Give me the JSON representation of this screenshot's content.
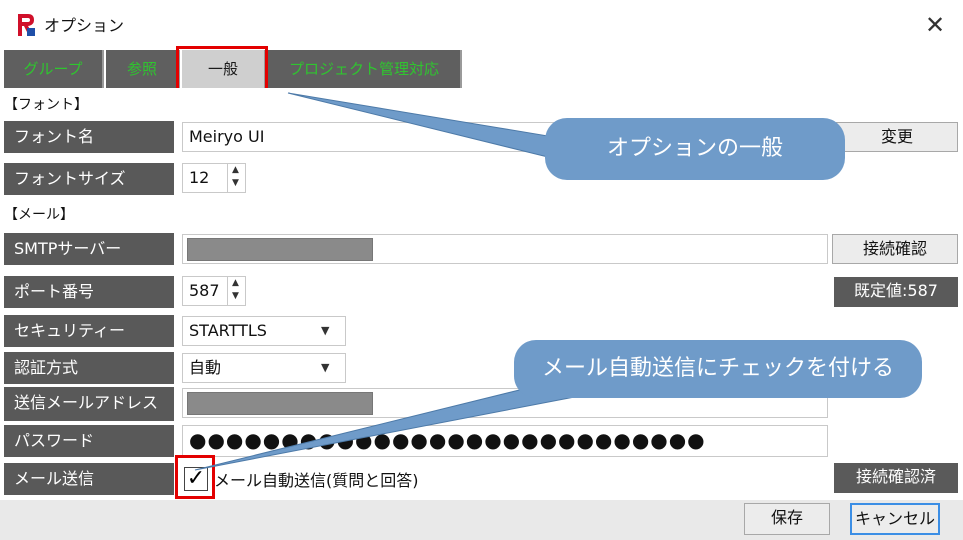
{
  "window": {
    "title": "オプション"
  },
  "tabs": [
    {
      "label": "グループ"
    },
    {
      "label": "参照"
    },
    {
      "label": "一般"
    },
    {
      "label": "プロジェクト管理対応"
    }
  ],
  "sections": {
    "font": "【フォント】",
    "mail": "【メール】"
  },
  "font": {
    "name_label": "フォント名",
    "name_value": "Meiryo UI",
    "change_button": "変更",
    "size_label": "フォントサイズ",
    "size_value": "12"
  },
  "mail": {
    "smtp_label": "SMTPサーバー",
    "connect_button": "接続確認",
    "port_label": "ポート番号",
    "port_value": "587",
    "port_default": "既定値:587",
    "security_label": "セキュリティー",
    "security_value": "STARTTLS",
    "auth_label": "認証方式",
    "auth_value": "自動",
    "address_label": "送信メールアドレス",
    "password_label": "パスワード",
    "password_value": "●●●●●●●●●●●●●●●●●●●●●●●●●●●●",
    "send_label": "メール送信",
    "auto_send_label": "メール自動送信(質問と回答)",
    "auto_send_checked": true,
    "status": "接続確認済"
  },
  "footer": {
    "save": "保存",
    "cancel": "キャンセル"
  },
  "callouts": {
    "general": "オプションの一般",
    "check": "メール自動送信にチェックを付ける"
  },
  "colors": {
    "highlight": "#e30000",
    "callout": "#6f9bc9",
    "tab_text": "#2fc52f",
    "label_bg": "#595959"
  }
}
